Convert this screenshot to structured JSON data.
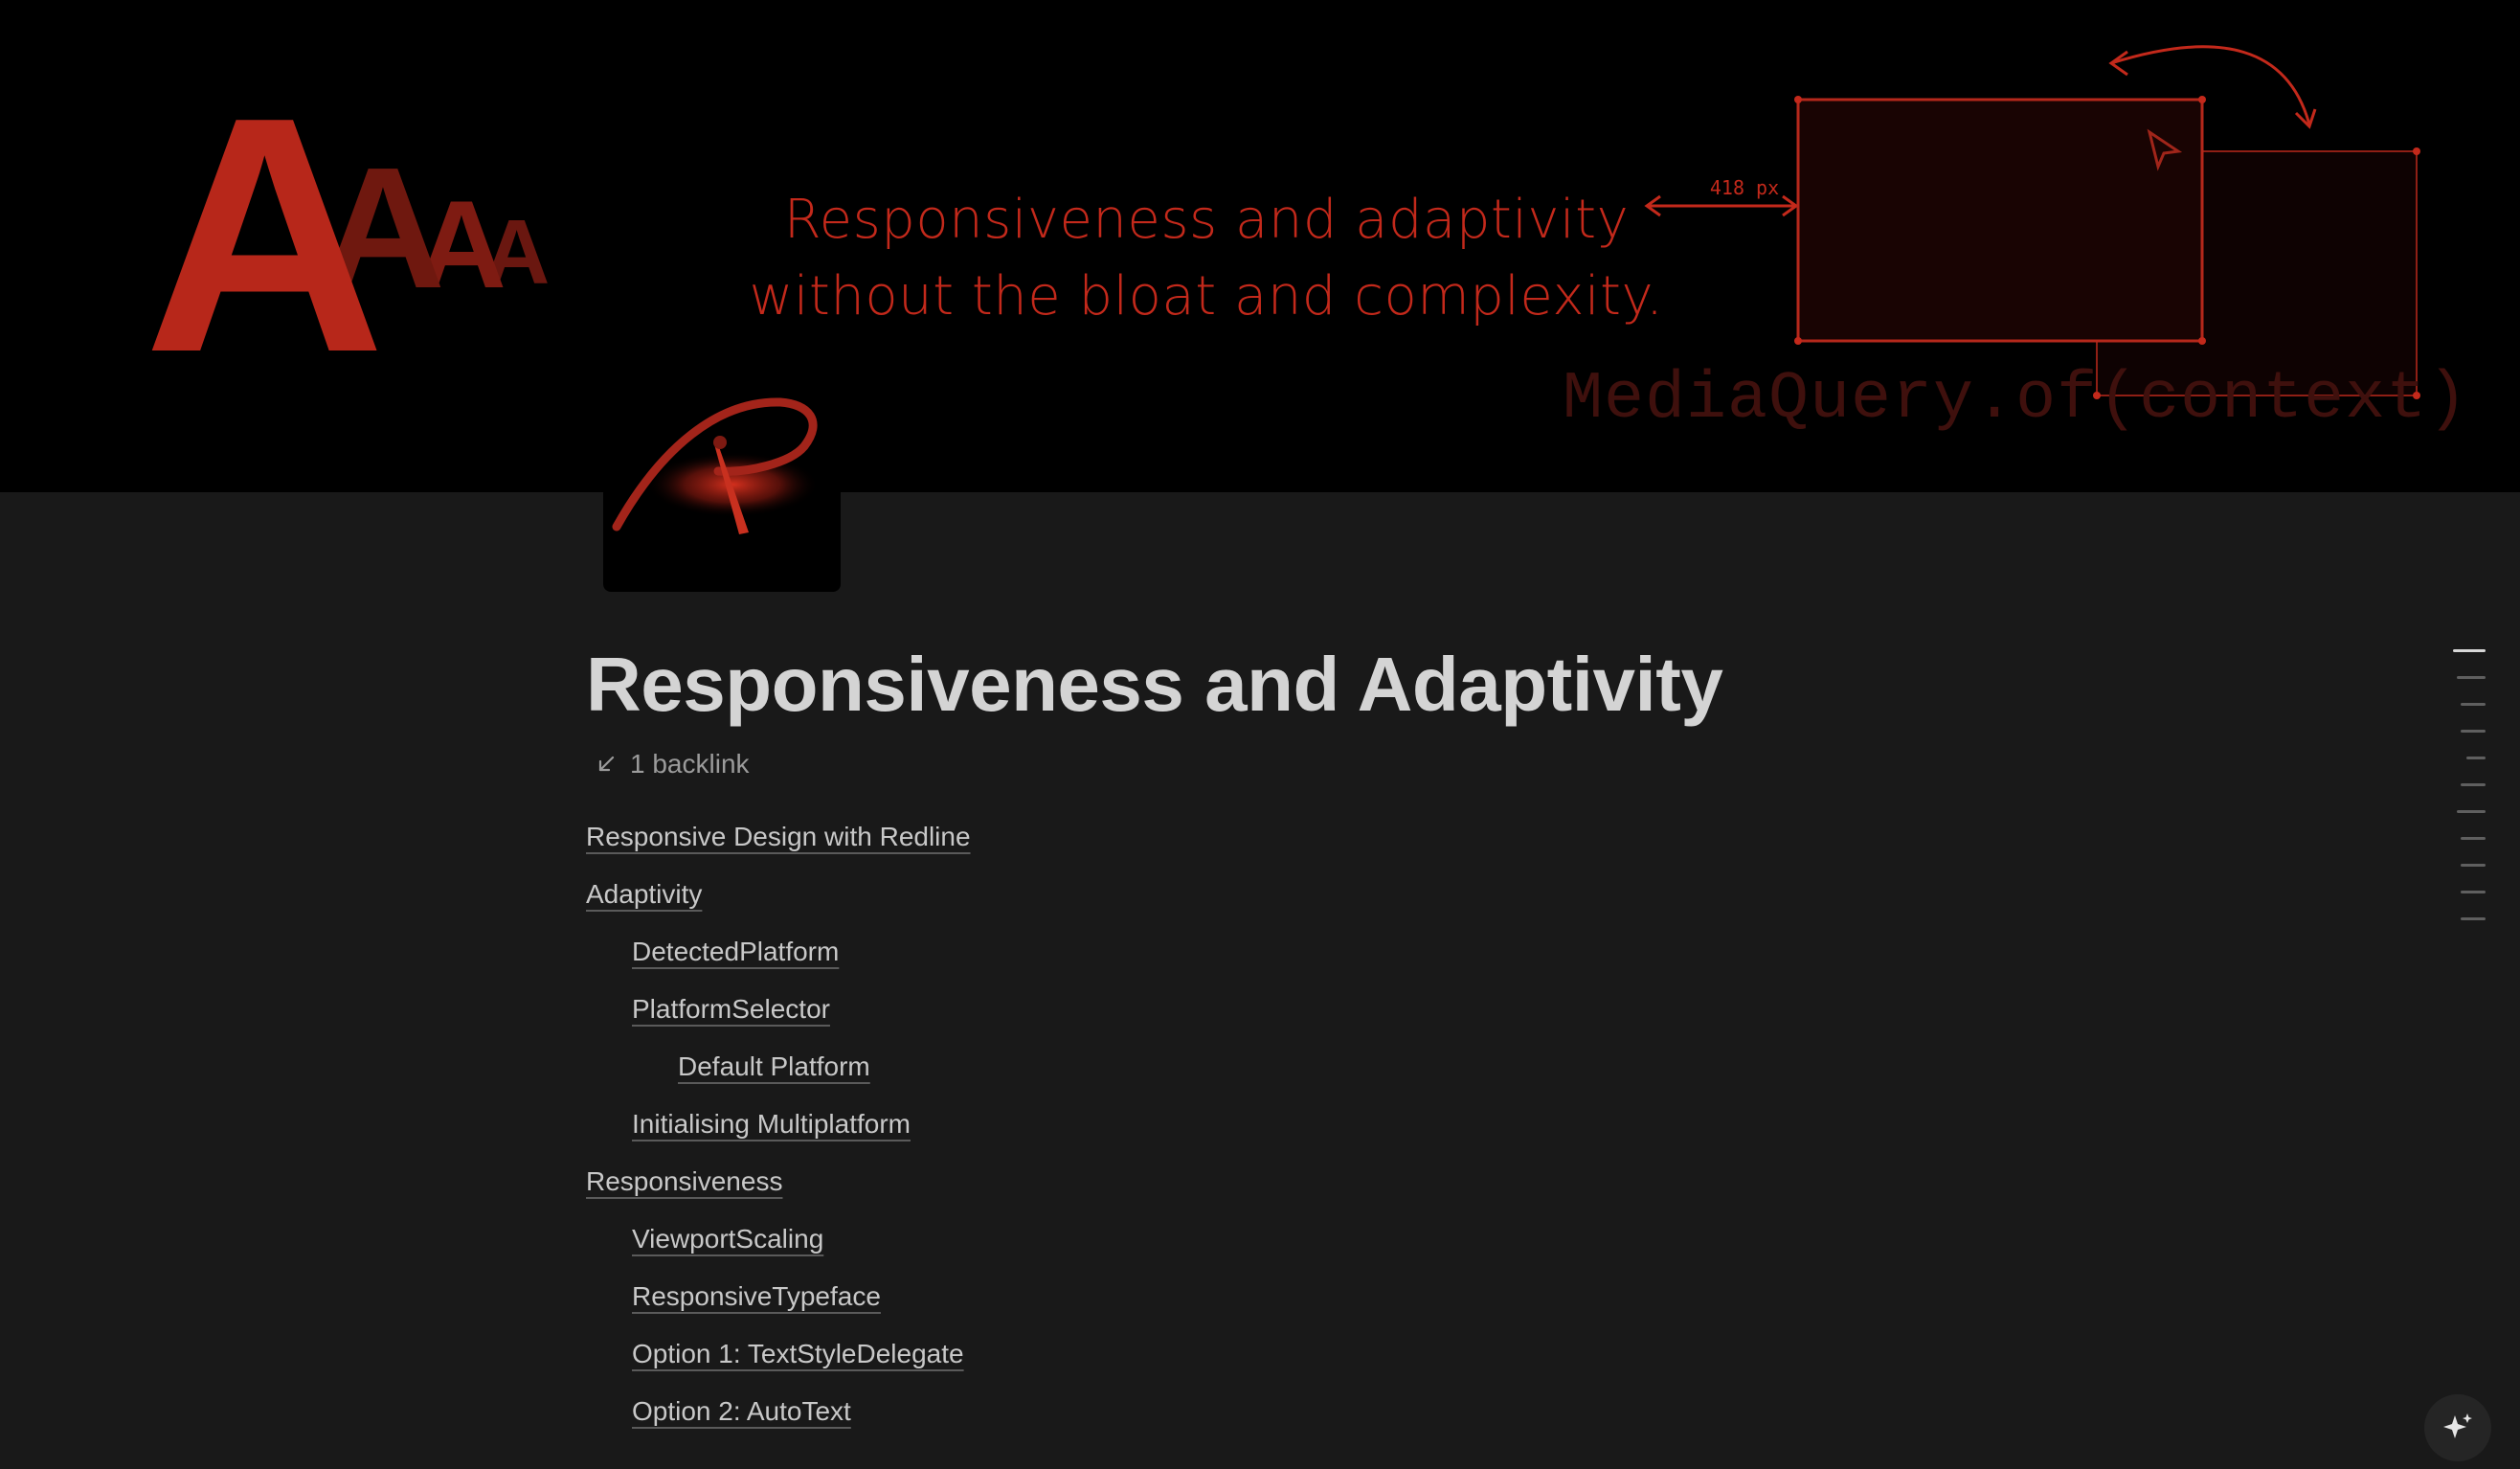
{
  "cover": {
    "tagline_line1": "Responsiveness and adaptivity",
    "tagline_line2": "without the bloat and complexity.",
    "width_label": "418 px",
    "code_text": "MediaQuery.of(context)",
    "accent_color": "#c3291b",
    "logo_letters": [
      "A",
      "A",
      "A",
      "A"
    ]
  },
  "page": {
    "title": "Responsiveness and Adaptivity",
    "backlinks": "1 backlink",
    "icon": "redline-logo"
  },
  "toc": [
    {
      "label": "Responsive Design with Redline",
      "level": 0
    },
    {
      "label": "Adaptivity",
      "level": 0
    },
    {
      "label": "DetectedPlatform",
      "level": 1
    },
    {
      "label": "PlatformSelector",
      "level": 1
    },
    {
      "label": "Default Platform",
      "level": 2
    },
    {
      "label": "Initialising Multiplatform",
      "level": 1
    },
    {
      "label": "Responsiveness",
      "level": 0
    },
    {
      "label": "ViewportScaling",
      "level": 1
    },
    {
      "label": "ResponsiveTypeface",
      "level": 1
    },
    {
      "label": "Option 1: TextStyleDelegate",
      "level": 1
    },
    {
      "label": "Option 2: AutoText",
      "level": 1
    }
  ],
  "outline_count": 11,
  "ai_button_icon": "sparkle-icon"
}
